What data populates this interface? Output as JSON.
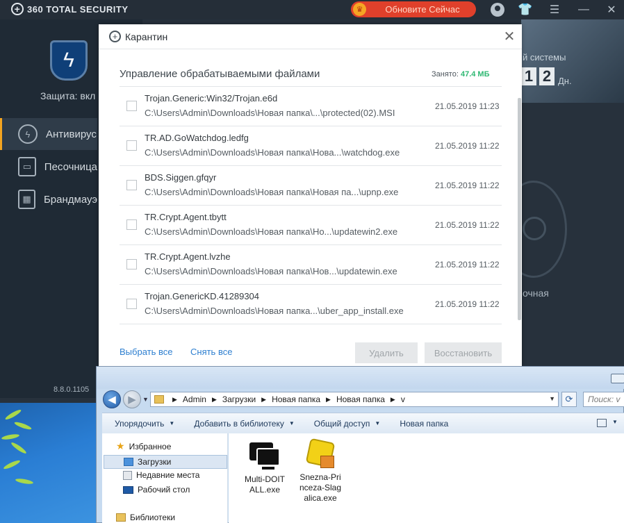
{
  "app": {
    "brand": "360 TOTAL SECURITY",
    "upgrade_button": "Обновите Сейчас",
    "protection_label": "Защита: вкл",
    "nav": [
      {
        "label": "Антивирус"
      },
      {
        "label": "Песочница"
      },
      {
        "label": "Брандмауэ"
      }
    ],
    "version": "8.8.0.1105",
    "banner_text": "й системы",
    "banner_digits": [
      "1",
      "2"
    ],
    "banner_days": "Дн.",
    "scan_label": "очная"
  },
  "dialog": {
    "title": "Карантин",
    "section_title": "Управление обрабатываемыми файлами",
    "occupied_label": "Занято:",
    "occupied_value": "47.4 МБ",
    "files": [
      {
        "threat": "Trojan.Generic:Win32/Trojan.e6d",
        "path": "C:\\Users\\Admin\\Downloads\\Новая папка\\...\\protected(02).MSI",
        "date": "21.05.2019 11:23"
      },
      {
        "threat": "TR.AD.GoWatchdog.ledfg",
        "path": "C:\\Users\\Admin\\Downloads\\Новая папка\\Нова...\\watchdog.exe",
        "date": "21.05.2019 11:22"
      },
      {
        "threat": "BDS.Siggen.gfqyr",
        "path": "C:\\Users\\Admin\\Downloads\\Новая папка\\Новая па...\\upnp.exe",
        "date": "21.05.2019 11:22"
      },
      {
        "threat": "TR.Crypt.Agent.tbytt",
        "path": "C:\\Users\\Admin\\Downloads\\Новая папка\\Но...\\updatewin2.exe",
        "date": "21.05.2019 11:22"
      },
      {
        "threat": "TR.Crypt.Agent.lvzhe",
        "path": "C:\\Users\\Admin\\Downloads\\Новая папка\\Нов...\\updatewin.exe",
        "date": "21.05.2019 11:22"
      },
      {
        "threat": "Trojan.GenericKD.41289304",
        "path": "C:\\Users\\Admin\\Downloads\\Новая папка...\\uber_app_install.exe",
        "date": "21.05.2019 11:22"
      }
    ],
    "select_all": "Выбрать все",
    "clear_all": "Снять все",
    "delete_button": "Удалить",
    "restore_button": "Восстановить"
  },
  "explorer": {
    "breadcrumbs": [
      "Admin",
      "Загрузки",
      "Новая папка",
      "Новая папка",
      "v"
    ],
    "search_placeholder": "Поиск: v",
    "toolbar": {
      "organize": "Упорядочить",
      "add_to_library": "Добавить в библиотеку",
      "share": "Общий доступ",
      "new_folder": "Новая папка"
    },
    "navpane": {
      "favorites": "Избранное",
      "downloads": "Загрузки",
      "recent": "Недавние места",
      "desktop": "Рабочий стол",
      "libraries": "Библиотеки"
    },
    "files": [
      {
        "name_line1": "Multi-DOIT",
        "name_line2": "ALL.exe",
        "name_line3": ""
      },
      {
        "name_line1": "Snezna-Pri",
        "name_line2": "nceza-Slag",
        "name_line3": "alica.exe"
      }
    ]
  },
  "colors": {
    "app_bg": "#27313c",
    "accent_orange": "#f3a420",
    "upgrade_red": "#e0402b",
    "occupied_green": "#2eb872",
    "link_blue": "#2e7fd0"
  }
}
